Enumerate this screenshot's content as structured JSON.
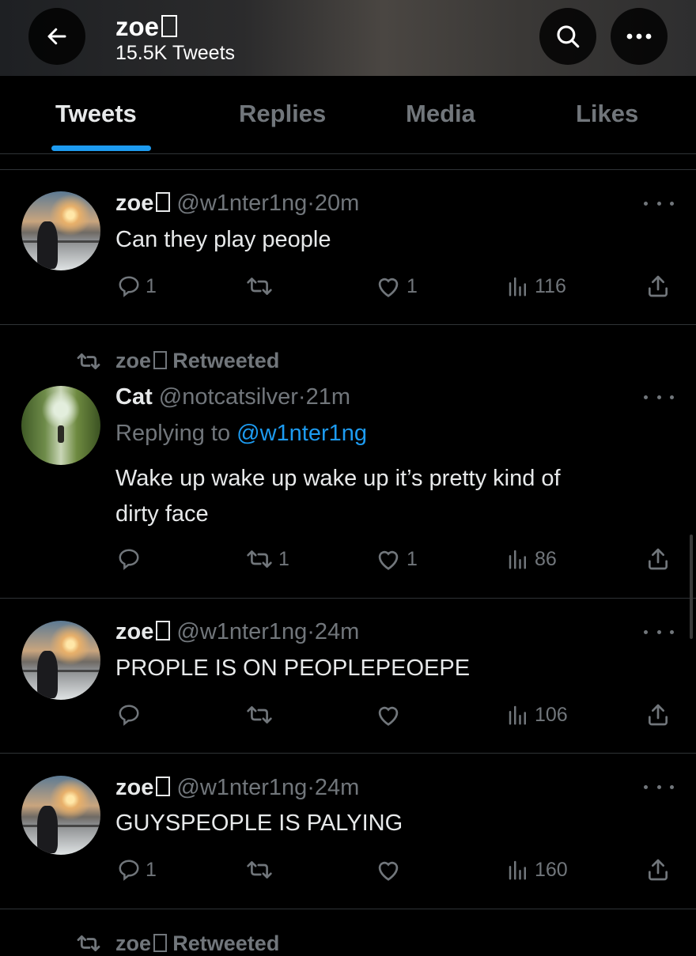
{
  "header": {
    "profile_name": "zoe",
    "tweet_count": "15.5K Tweets",
    "icons": [
      "back-arrow-icon",
      "search-icon",
      "more-icon"
    ]
  },
  "tabs": [
    {
      "label": "Tweets",
      "active": true
    },
    {
      "label": "Replies",
      "active": false
    },
    {
      "label": "Media",
      "active": false
    },
    {
      "label": "Likes",
      "active": false
    }
  ],
  "tweets": [
    {
      "name": "zoe",
      "handle": "@w1nter1ng",
      "sep": "·",
      "time": "20m",
      "text": "Can they play people",
      "replies": "1",
      "retweets": "",
      "likes": "1",
      "views": "116"
    },
    {
      "retweeted_by": "zoe",
      "retweeted_label": "Retweeted",
      "name": "Cat",
      "handle": "@notcatsilver",
      "sep": "·",
      "time": "21m",
      "replying_prefix": "Replying to",
      "replying_handle": "@w1nter1ng",
      "text_line1": "Wake up wake up wake up it’s pretty kind of",
      "text_line2": "dirty face",
      "replies": "",
      "retweets": "1",
      "likes": "1",
      "views": "86"
    },
    {
      "name": "zoe",
      "handle": "@w1nter1ng",
      "sep": "·",
      "time": "24m",
      "text": "PROPLE IS ON PEOPLEPEOEPE",
      "replies": "",
      "retweets": "",
      "likes": "",
      "views": "106"
    },
    {
      "name": "zoe",
      "handle": "@w1nter1ng",
      "sep": "·",
      "time": "24m",
      "text": "GUYSPEOPLE IS PALYING",
      "replies": "1",
      "retweets": "",
      "likes": "",
      "views": "160"
    }
  ],
  "next_retweet": {
    "retweeted_by": "zoe",
    "retweeted_label": "Retweeted"
  },
  "colors": {
    "accent": "#1d9bf0",
    "muted": "#71767b",
    "background": "#000000"
  }
}
